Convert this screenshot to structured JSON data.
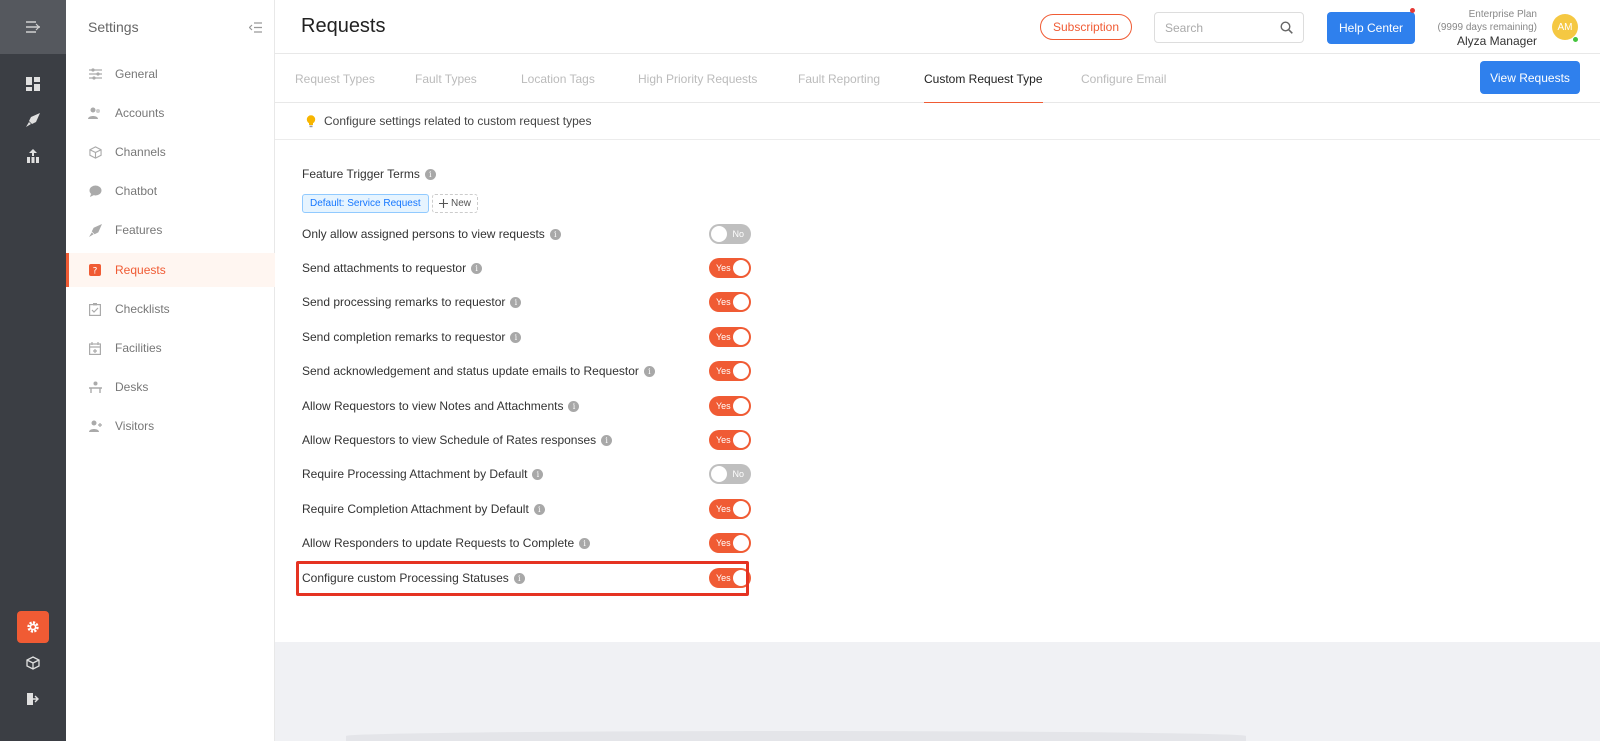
{
  "sidebar": {
    "title": "Settings",
    "items": [
      {
        "label": "General",
        "icon": "sliders-icon"
      },
      {
        "label": "Accounts",
        "icon": "users-icon"
      },
      {
        "label": "Channels",
        "icon": "cube-icon"
      },
      {
        "label": "Chatbot",
        "icon": "chat-icon"
      },
      {
        "label": "Features",
        "icon": "rocket-icon"
      },
      {
        "label": "Requests",
        "icon": "question-icon"
      },
      {
        "label": "Checklists",
        "icon": "checklist-icon"
      },
      {
        "label": "Facilities",
        "icon": "calendar-icon"
      },
      {
        "label": "Desks",
        "icon": "desk-icon"
      },
      {
        "label": "Visitors",
        "icon": "visitor-icon"
      }
    ],
    "active": "Requests"
  },
  "header": {
    "title": "Requests",
    "subscription_label": "Subscription",
    "search_placeholder": "Search",
    "help_label": "Help Center",
    "plan_line1": "Enterprise Plan",
    "plan_line2": "(9999 days remaining)",
    "user_name": "Alyza Manager",
    "avatar_initials": "AM"
  },
  "tabs": {
    "items": [
      "Request Types",
      "Fault Types",
      "Location Tags",
      "High Priority Requests",
      "Fault Reporting",
      "Custom Request Type",
      "Configure Email"
    ],
    "active": "Custom Request Type",
    "view_requests_label": "View Requests"
  },
  "info": {
    "text": "Configure settings related to custom request types"
  },
  "form": {
    "feature_trigger_label": "Feature Trigger Terms",
    "default_tag": "Default: Service Request",
    "new_tag_label": "New",
    "settings": [
      {
        "label": "Only allow assigned persons to view requests",
        "state": "No"
      },
      {
        "label": "Send attachments to requestor",
        "state": "Yes"
      },
      {
        "label": "Send processing remarks to requestor",
        "state": "Yes"
      },
      {
        "label": "Send completion remarks to requestor",
        "state": "Yes"
      },
      {
        "label": "Send acknowledgement and status update emails to Requestor",
        "state": "Yes"
      },
      {
        "label": "Allow Requestors to view Notes and Attachments",
        "state": "Yes"
      },
      {
        "label": "Allow Requestors to view Schedule of Rates responses",
        "state": "Yes"
      },
      {
        "label": "Require Processing Attachment by Default",
        "state": "No"
      },
      {
        "label": "Require Completion Attachment by Default",
        "state": "Yes"
      },
      {
        "label": "Allow Responders to update Requests to Complete",
        "state": "Yes"
      },
      {
        "label": "Configure custom Processing Statuses",
        "state": "Yes"
      }
    ]
  },
  "colors": {
    "accent": "#f05b34",
    "primary": "#2f80ed",
    "rail": "#3b3e44"
  }
}
